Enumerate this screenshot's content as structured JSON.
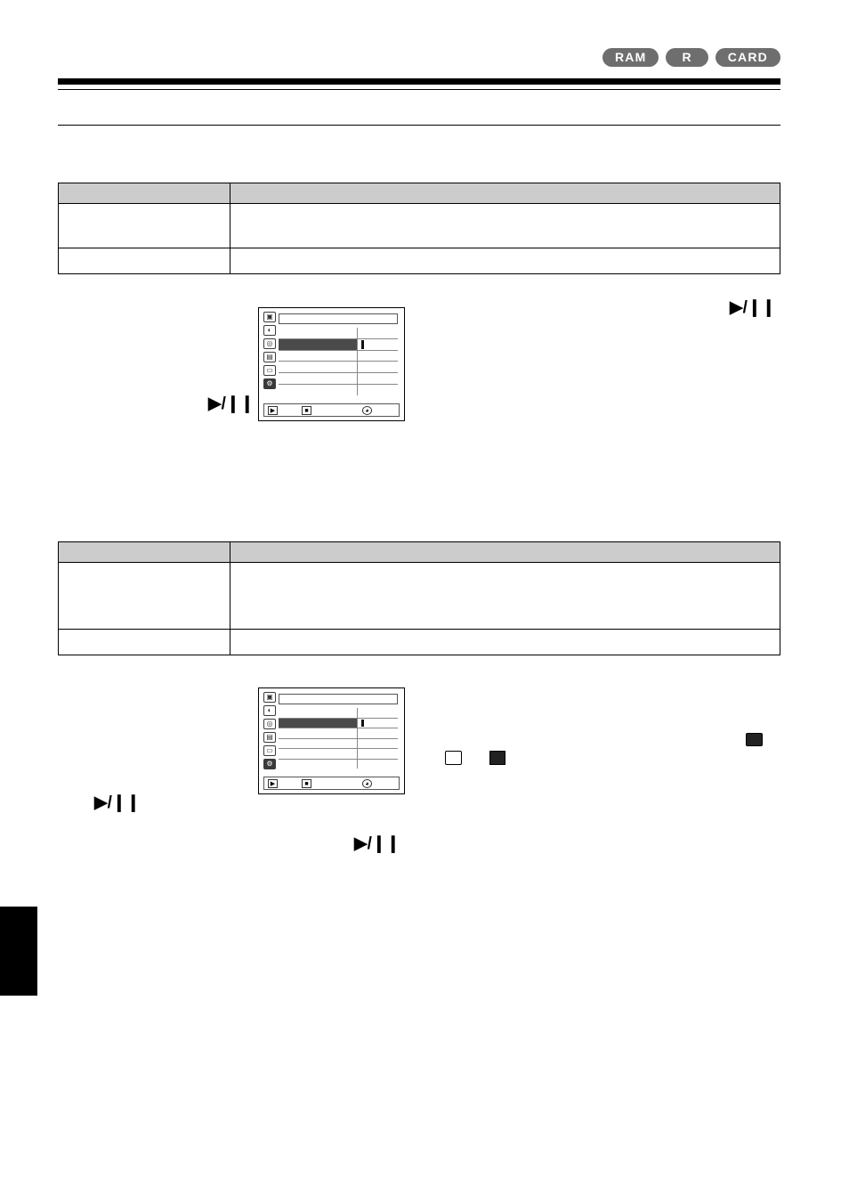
{
  "page": {
    "media_badges": [
      {
        "label": "RAM",
        "name": "badge-ram"
      },
      {
        "label": "R",
        "name": "badge-r"
      },
      {
        "label": "CARD",
        "name": "badge-card"
      }
    ]
  },
  "section_one": {
    "table": {
      "header": {
        "col1": "",
        "col2": ""
      },
      "rows": [
        {
          "col1": "",
          "col2": ""
        },
        {
          "col1": "",
          "col2": ""
        }
      ]
    },
    "screen": {
      "title": "",
      "menu_icons": [
        "",
        "",
        "",
        "",
        "",
        "",
        ""
      ],
      "selected_icon_index": 6,
      "rows": [
        {
          "label": "",
          "value": "",
          "highlighted": false
        },
        {
          "label": "",
          "value": "",
          "highlighted": true
        },
        {
          "label": "",
          "value": "",
          "highlighted": false
        },
        {
          "label": "",
          "value": "",
          "highlighted": false
        },
        {
          "label": "",
          "value": "",
          "highlighted": false
        },
        {
          "label": "",
          "value": "",
          "highlighted": false
        }
      ],
      "bottom_icons": [
        "play-icon",
        "stop-icon",
        "clock-icon"
      ]
    },
    "play_pause_left": "▶/❙❙",
    "play_pause_right": "▶/❙❙"
  },
  "section_two": {
    "table": {
      "header": {
        "col1": "",
        "col2": ""
      },
      "rows": [
        {
          "col1": "",
          "col2": ""
        },
        {
          "col1": "",
          "col2": ""
        }
      ]
    },
    "screen": {
      "title": "",
      "menu_icons": [
        "",
        "",
        "",
        "",
        "",
        "",
        ""
      ],
      "selected_icon_index": 6,
      "rows": [
        {
          "label": "",
          "value": "",
          "highlighted": false
        },
        {
          "label": "",
          "value": "",
          "highlighted": true
        },
        {
          "label": "",
          "value": "",
          "highlighted": false
        },
        {
          "label": "",
          "value": "",
          "highlighted": false
        },
        {
          "label": "",
          "value": "",
          "highlighted": false
        },
        {
          "label": "",
          "value": "",
          "highlighted": false
        }
      ],
      "bottom_icons": [
        "play-icon",
        "stop-icon",
        "clock-icon"
      ]
    },
    "play_pause_left": "▶/❙❙",
    "play_pause_center": "▶/❙❙",
    "symbols": {
      "still_camera": "still-picture-icon",
      "film_strip": "film-strip-icon",
      "movie_camera": "movie-camera-icon"
    }
  }
}
